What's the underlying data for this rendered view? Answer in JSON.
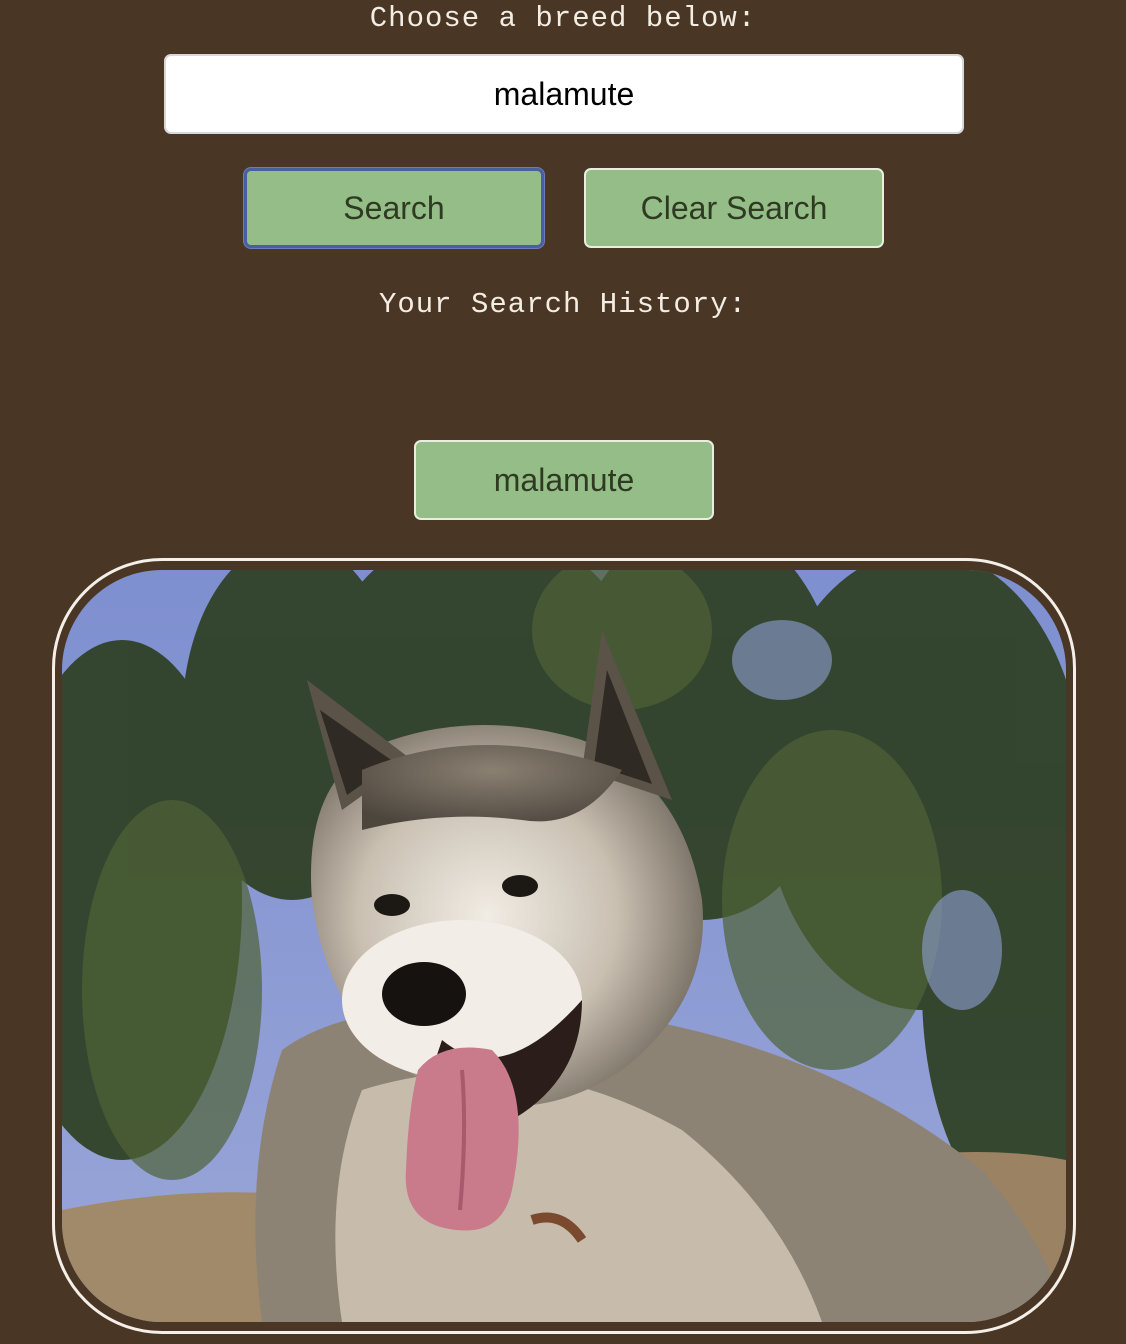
{
  "prompt": {
    "text": "Choose a breed below:"
  },
  "search": {
    "value": "malamute",
    "search_label": "Search",
    "clear_label": "Clear Search"
  },
  "history": {
    "title": "Your Search History:",
    "items": [
      {
        "label": "malamute"
      }
    ]
  },
  "image": {
    "subject": "malamute"
  },
  "colors": {
    "background": "#4a3624",
    "button": "#94bd87",
    "button_text": "#2f3a22",
    "focus_ring": "#4a5fa0"
  }
}
